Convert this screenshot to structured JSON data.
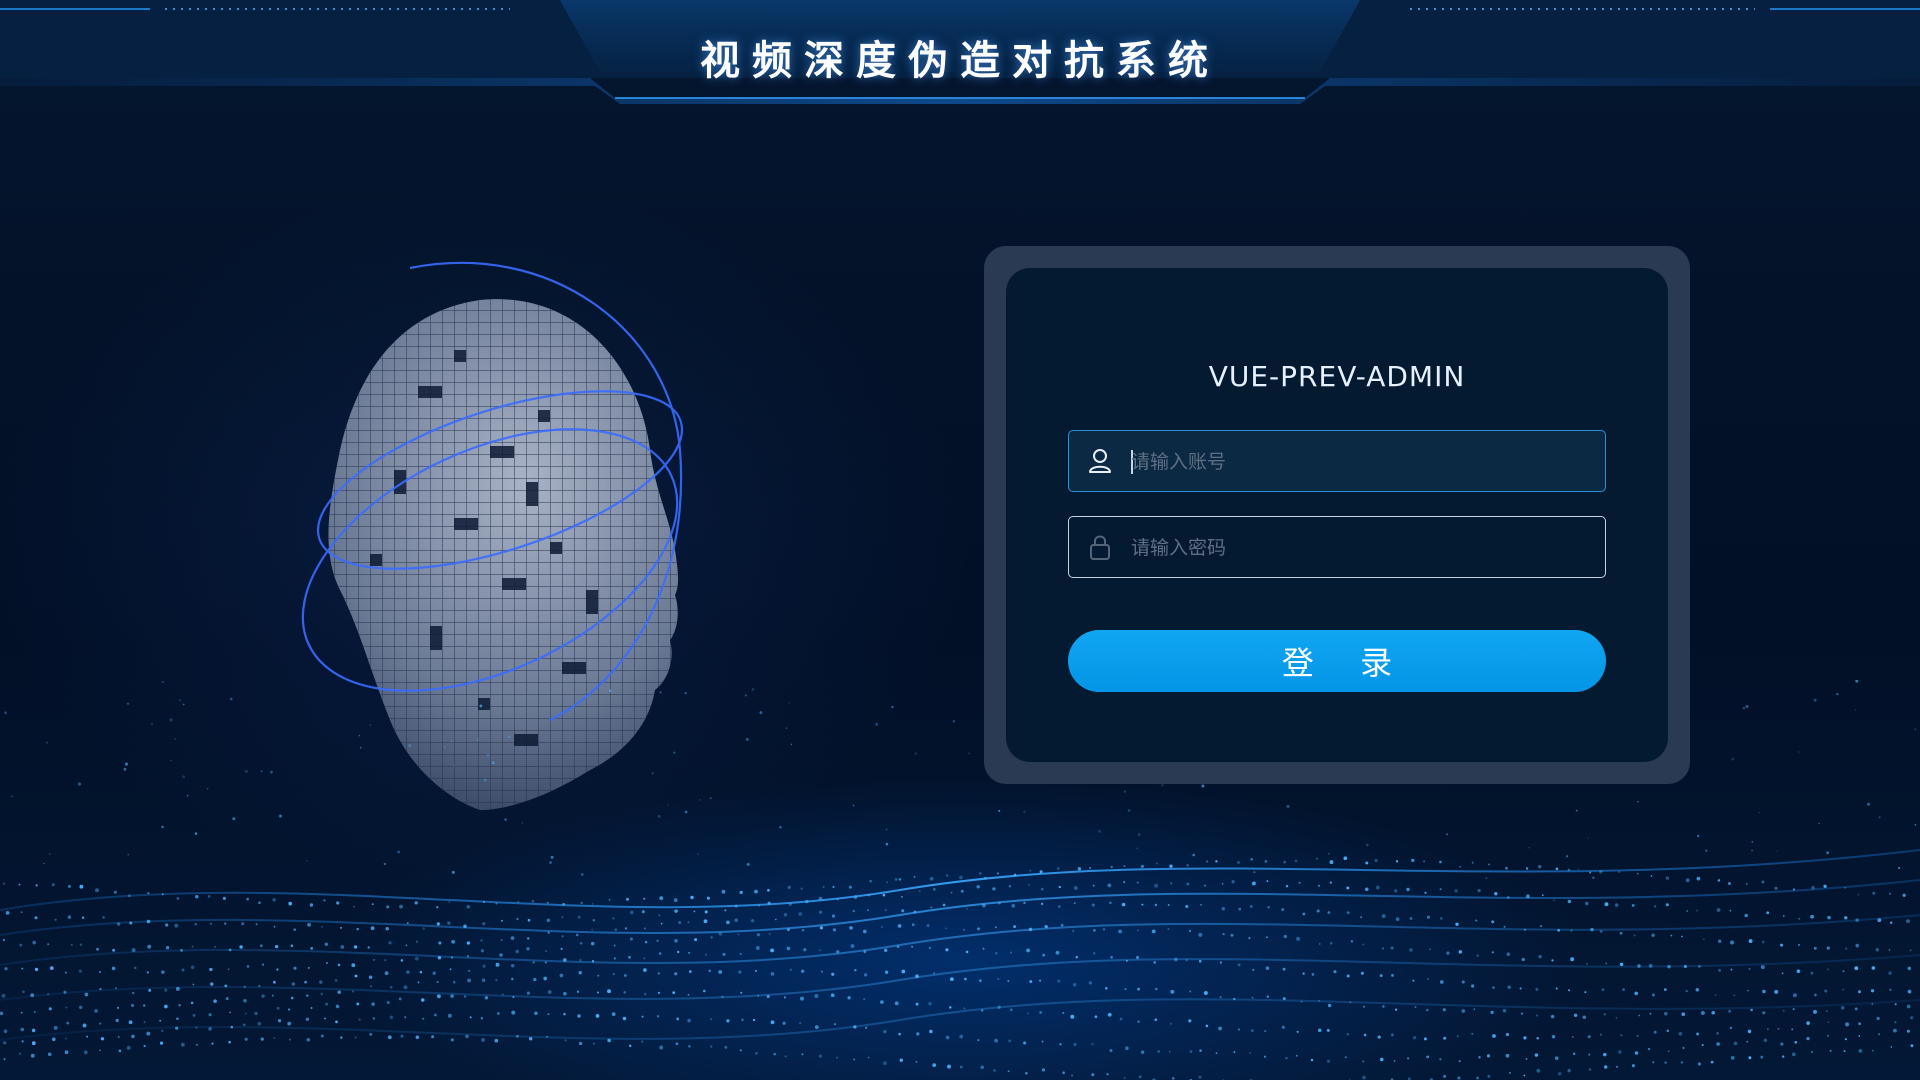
{
  "header": {
    "title": "视频深度伪造对抗系统"
  },
  "login": {
    "app_name": "VUE-PREV-ADMIN",
    "username": {
      "value": "",
      "placeholder": "请输入账号",
      "icon": "user-icon"
    },
    "password": {
      "value": "",
      "placeholder": "请输入密码",
      "icon": "lock-icon"
    },
    "submit_label": "登 录"
  },
  "colors": {
    "background": "#021027",
    "accent": "#0a9ff0",
    "card_frame": "#2a3a52",
    "card_body": "#041a30",
    "focused_border": "#2a8fd6"
  }
}
